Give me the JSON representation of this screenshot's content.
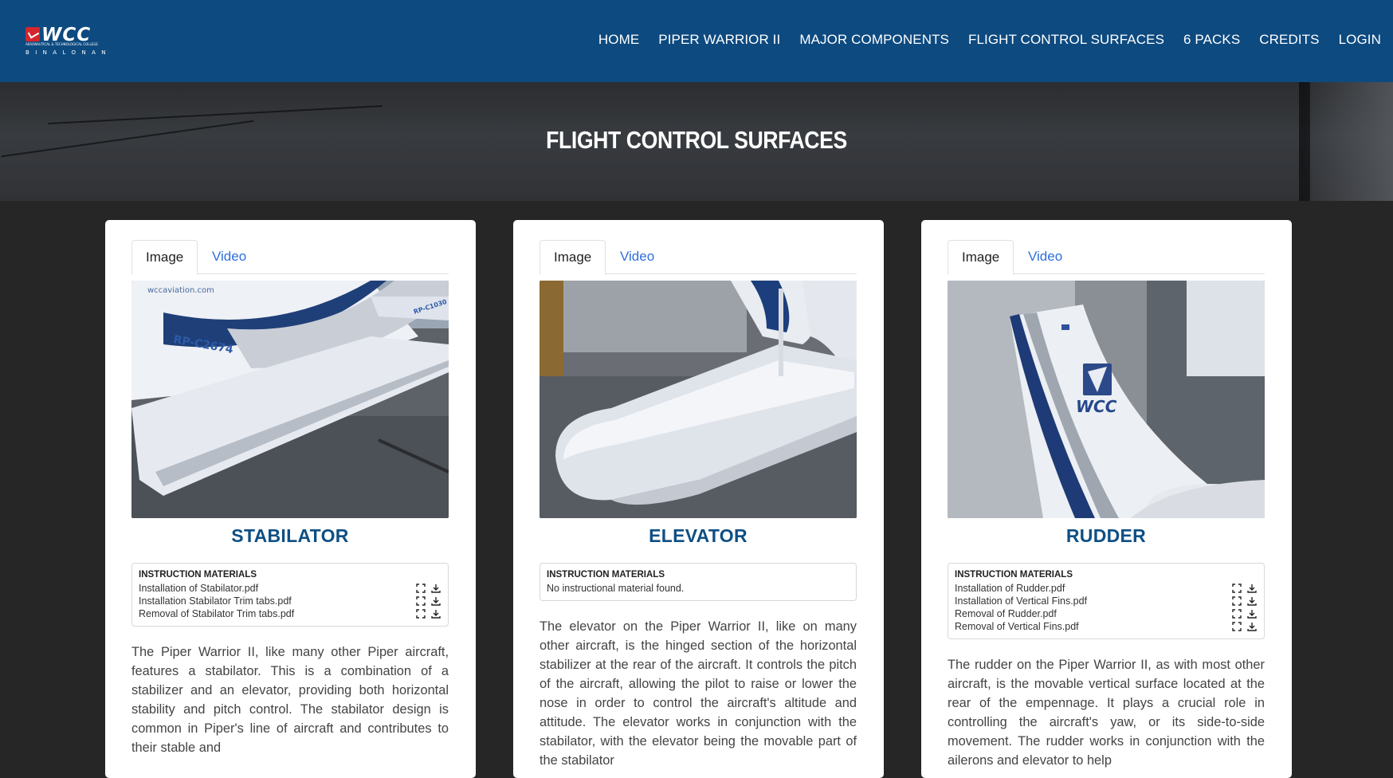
{
  "brand": {
    "name": "WCC",
    "tagline": "AERONAUTICAL & TECHNOLOGICAL COLLEGE",
    "city": "BINALONAN"
  },
  "nav": {
    "items": [
      "HOME",
      "PIPER WARRIOR II",
      "MAJOR COMPONENTS",
      "FLIGHT CONTROL SURFACES",
      "6 PACKS",
      "CREDITS",
      "LOGIN"
    ]
  },
  "hero": {
    "title": "FLIGHT CONTROL SURFACES"
  },
  "cards": [
    {
      "tabs": [
        "Image",
        "Video"
      ],
      "title": "STABILATOR",
      "materials_heading": "INSTRUCTION MATERIALS",
      "materials": [
        "Installation of Stabilator.pdf",
        "Installation Stabilator Trim tabs.pdf",
        "Removal of Stabilator Trim tabs.pdf"
      ],
      "description": "The Piper Warrior II, like many other Piper aircraft, features a stabilator. This is a combination of a stabilizer and an elevator, providing both horizontal stability and pitch control. The stabilator design is common in Piper's line of aircraft and contributes to their stable and",
      "photo": {
        "registration": "RP-C2674",
        "registration_2": "RP-C1030",
        "watermark": "wccaviation.com"
      }
    },
    {
      "tabs": [
        "Image",
        "Video"
      ],
      "title": "ELEVATOR",
      "materials_heading": "INSTRUCTION MATERIALS",
      "no_materials": "No instructional material found.",
      "description": "The elevator on the Piper Warrior II, like on many other aircraft, is the hinged section of the horizontal stabilizer at the rear of the aircraft. It controls the pitch of the aircraft, allowing the pilot to raise or lower the nose in order to control the aircraft's altitude and attitude. The elevator works in conjunction with the stabilator, with the elevator being the movable part of the stabilator"
    },
    {
      "tabs": [
        "Image",
        "Video"
      ],
      "title": "RUDDER",
      "materials_heading": "INSTRUCTION MATERIALS",
      "materials": [
        "Installation of Rudder.pdf",
        "Installation of Vertical Fins.pdf",
        "Removal of Rudder.pdf",
        "Removal of Vertical Fins.pdf"
      ],
      "description": "The rudder on the Piper Warrior II, as with most other aircraft, is the movable vertical surface located at the rear of the empennage. It plays a crucial role in controlling the aircraft's yaw, or its side-to-side movement. The rudder works in conjunction with the ailerons and elevator to help",
      "photo": {
        "logo_text": "WCC"
      }
    }
  ],
  "colors": {
    "navbar": "#0d4a80",
    "accent_title": "#0e4f84",
    "tab_link": "#2f6fdc",
    "page_bg": "#262626"
  },
  "icons": {
    "expand": "expand-icon",
    "download": "download-icon"
  }
}
